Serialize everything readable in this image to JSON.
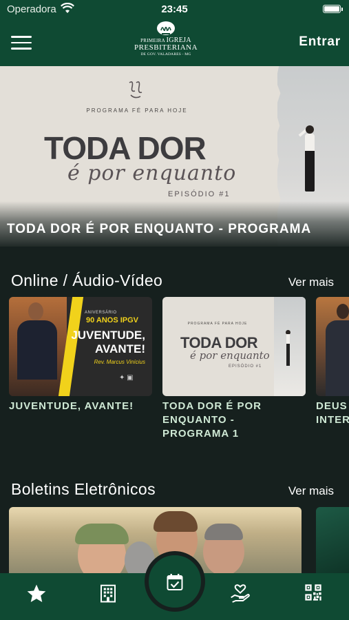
{
  "status_bar": {
    "carrier": "Operadora",
    "time": "23:45"
  },
  "header": {
    "logo": {
      "line1_small": "PRIMEIRA",
      "line1_big": "IGREJA",
      "line2": "PRESBITERIANA",
      "line3": "DE GOV. VALADARES - MG"
    },
    "login_label": "Entrar"
  },
  "hero": {
    "program": "PROGRAMA FÉ PARA HOJE",
    "big_text": "TODA DOR",
    "script_text": "é por enquanto",
    "episode": "EPISÓDIO #1",
    "caption": "TODA DOR É POR ENQUANTO - PROGRAMA"
  },
  "online_section": {
    "title": "Online / Áudio-Vídeo",
    "more_label": "Ver mais",
    "items": [
      {
        "title": "JUVENTUDE, AVANTE!",
        "thumb": {
          "anniv": "ANIVERSÁRIO",
          "years": "90 ANOS IPGV",
          "headline_1": "JUVENTUDE,",
          "headline_2": "AVANTE!",
          "speaker": "Rev. Marcus Vinícius"
        }
      },
      {
        "title_1": "TODA DOR É POR",
        "title_2": "ENQUANTO -",
        "title_3": "PROGRAMA 1",
        "thumb": {
          "program": "PROGRAMA FÉ PARA HOJE",
          "big": "TODA DOR",
          "script": "é por enquanto",
          "episode": "EPISÓDIO #1"
        }
      },
      {
        "title_1": "DEUS",
        "title_2": "INTER"
      }
    ]
  },
  "bulletins_section": {
    "title": "Boletins Eletrônicos",
    "more_label": "Ver mais"
  },
  "tabbar": {
    "icons": [
      "star-icon",
      "building-icon",
      "calendar-check-icon",
      "hand-heart-icon",
      "qr-code-icon"
    ]
  },
  "colors": {
    "brand_green": "#0f4a33",
    "background": "#16201e",
    "card_title": "#cfe9d5",
    "accent_yellow": "#f1d21b"
  }
}
